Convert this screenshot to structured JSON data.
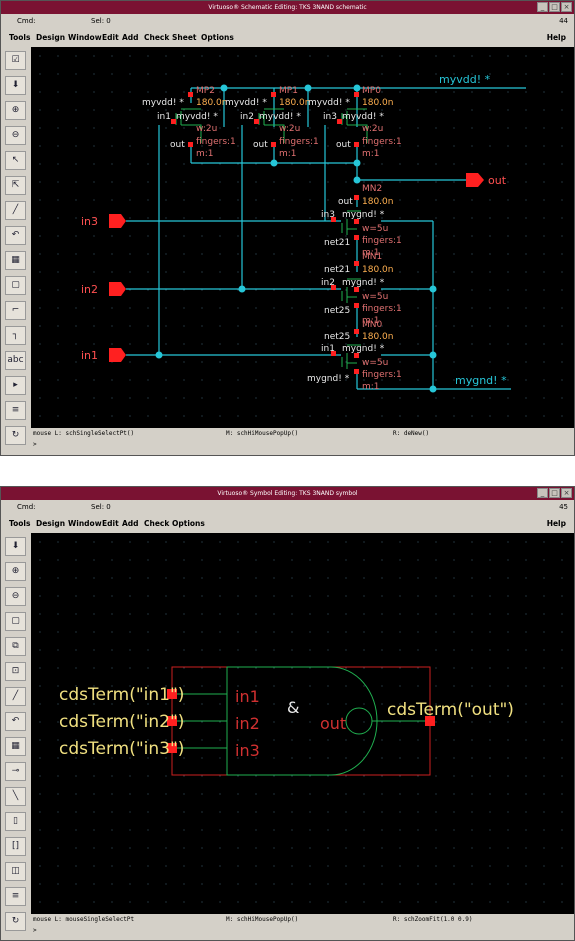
{
  "window1": {
    "title": "Virtuoso® Schematic Editing: TKS 3NAND schematic",
    "cmd_label": "Cmd:",
    "sel_label": "Sel: 0",
    "counter": "44",
    "menus": [
      "Tools",
      "Design",
      "Window",
      "Edit",
      "Add",
      "Check",
      "Sheet",
      "Options"
    ],
    "help": "Help",
    "status": {
      "left": "mouse L: schSingleSelectPt()",
      "middle": "M: schHiMousePopUp()",
      "right": "R: deNew()"
    },
    "prompt": ">",
    "schematic": {
      "pins": {
        "in3": "in3",
        "in2": "in2",
        "in1": "in1",
        "out": "out",
        "myvdd": "myvdd! *",
        "mygnd": "mygnd! *"
      },
      "labels": {
        "mp0": "MP0",
        "mp1": "MP1",
        "mp2": "MP2",
        "mn2": "MN2",
        "mn1": "MN1",
        "mn0": "MN0",
        "len": "180.0n",
        "myvdd": "myvdd! *",
        "wp": "w:2u",
        "wn": "w=5u",
        "fingers": "fingers:1",
        "m": "m:1",
        "out": "out",
        "in1": "in1",
        "in2": "in2",
        "in3": "in3",
        "mygnd": "mygnd! *",
        "net21": "net21",
        "net25": "net25"
      }
    }
  },
  "window2": {
    "title": "Virtuoso® Symbol Editing: TKS 3NAND symbol",
    "cmd_label": "Cmd:",
    "sel_label": "Sel: 0",
    "counter": "45",
    "menus": [
      "Tools",
      "Design",
      "Window",
      "Edit",
      "Add",
      "Check",
      "Options"
    ],
    "help": "Help",
    "status": {
      "left": "mouse L: mouseSingleSelectPt",
      "middle": "M: schHiMousePopUp()",
      "right": "R: schZoomFit(1.0 0.9)"
    },
    "prompt": ">",
    "symbol": {
      "cds_in1": "cdsTerm(\"in1\")",
      "cds_in2": "cdsTerm(\"in2\")",
      "cds_in3": "cdsTerm(\"in3\")",
      "cds_out": "cdsTerm(\"out\")",
      "pin_in1": "in1",
      "pin_in2": "in2",
      "pin_in3": "in3",
      "pin_out": "out",
      "amp": "&"
    }
  },
  "colors": {
    "wire": "#26c6d8",
    "pin": "#ff2020",
    "text": "#e8e8e8",
    "inst": "#e07070",
    "green": "#20b050",
    "yellow": "#f0e080",
    "titlebar": "#7a1232"
  }
}
